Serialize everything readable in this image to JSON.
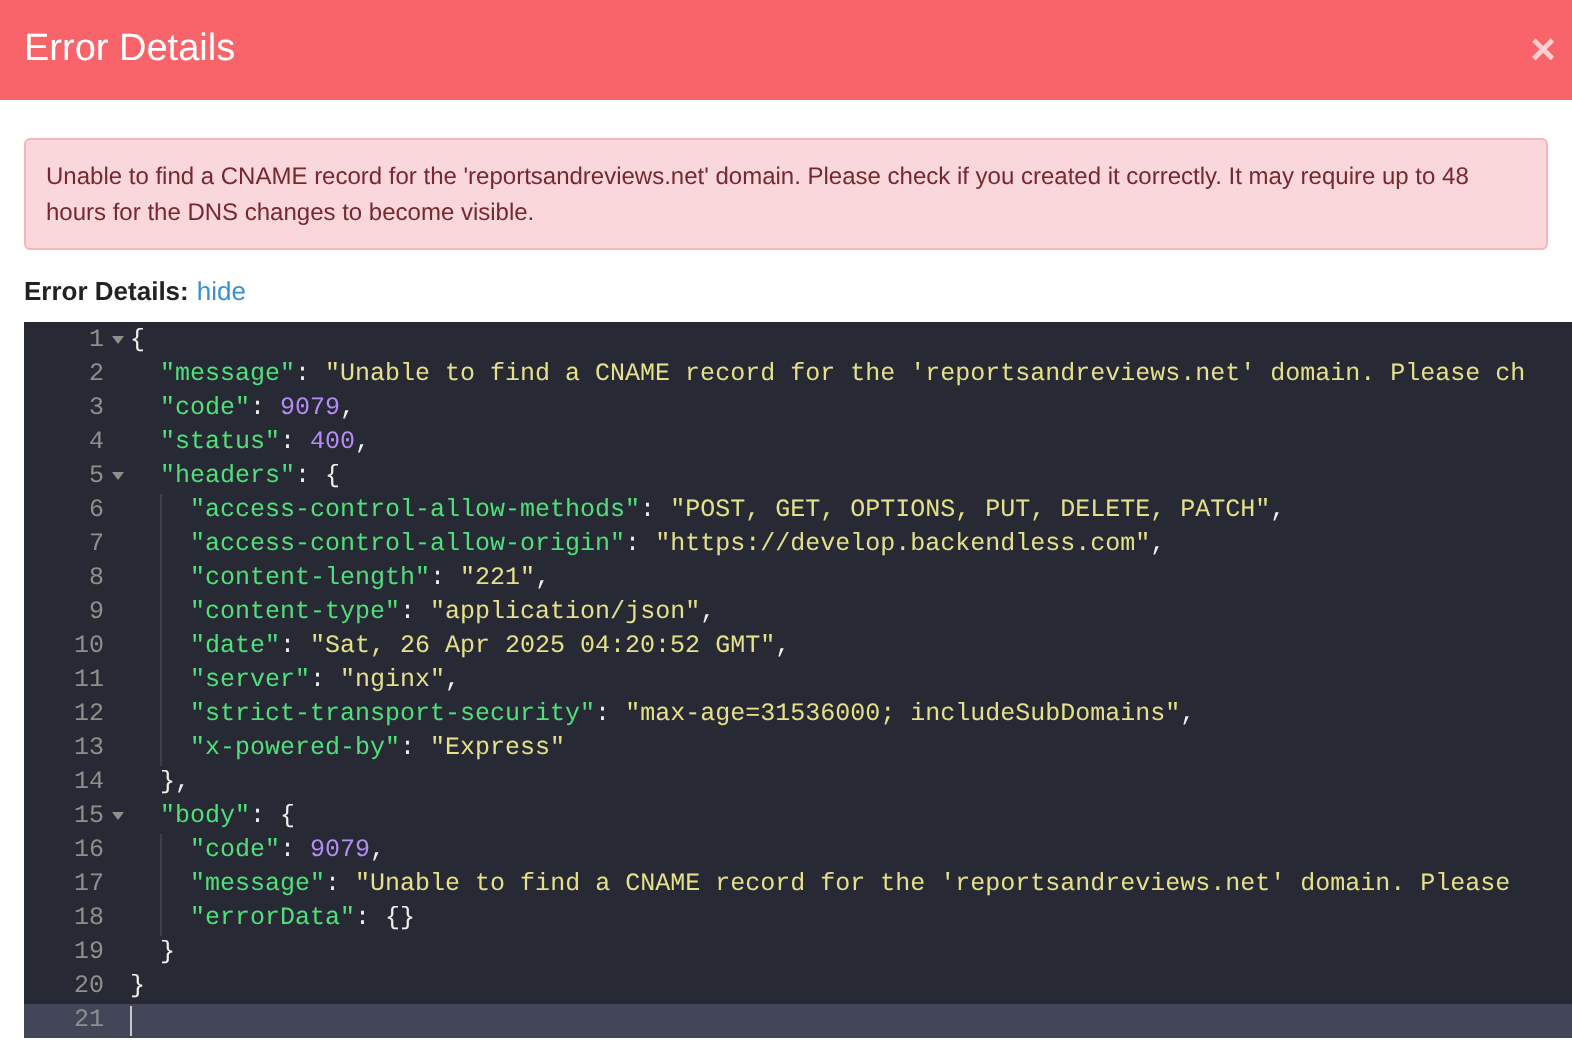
{
  "dialog": {
    "title": "Error Details",
    "close": "×"
  },
  "alert": {
    "text": "Unable to find a CNAME record for the 'reportsandreviews.net' domain. Please check if you created it correctly. It may require up to 48 hours for the DNS changes to become visible."
  },
  "details": {
    "label": "Error Details:",
    "toggle": "hide"
  },
  "editor": {
    "lines": [
      {
        "number": "1",
        "foldable": true,
        "active": false,
        "tokens": [
          {
            "kind": "punct",
            "text": "{"
          }
        ]
      },
      {
        "number": "2",
        "foldable": false,
        "active": false,
        "tokens": [
          {
            "kind": "key",
            "text": "  \"message\""
          },
          {
            "kind": "punct",
            "text": ": "
          },
          {
            "kind": "string",
            "text": "\"Unable to find a CNAME record for the 'reportsandreviews.net' domain. Please ch"
          }
        ]
      },
      {
        "number": "3",
        "foldable": false,
        "active": false,
        "tokens": [
          {
            "kind": "key",
            "text": "  \"code\""
          },
          {
            "kind": "punct",
            "text": ": "
          },
          {
            "kind": "number",
            "text": "9079"
          },
          {
            "kind": "punct",
            "text": ","
          }
        ]
      },
      {
        "number": "4",
        "foldable": false,
        "active": false,
        "tokens": [
          {
            "kind": "key",
            "text": "  \"status\""
          },
          {
            "kind": "punct",
            "text": ": "
          },
          {
            "kind": "number",
            "text": "400"
          },
          {
            "kind": "punct",
            "text": ","
          }
        ]
      },
      {
        "number": "5",
        "foldable": true,
        "active": false,
        "tokens": [
          {
            "kind": "key",
            "text": "  \"headers\""
          },
          {
            "kind": "punct",
            "text": ": {"
          }
        ]
      },
      {
        "number": "6",
        "foldable": false,
        "active": false,
        "tokens": [
          {
            "kind": "key",
            "text": "    \"access-control-allow-methods\""
          },
          {
            "kind": "punct",
            "text": ": "
          },
          {
            "kind": "string",
            "text": "\"POST, GET, OPTIONS, PUT, DELETE, PATCH\""
          },
          {
            "kind": "punct",
            "text": ","
          }
        ]
      },
      {
        "number": "7",
        "foldable": false,
        "active": false,
        "tokens": [
          {
            "kind": "key",
            "text": "    \"access-control-allow-origin\""
          },
          {
            "kind": "punct",
            "text": ": "
          },
          {
            "kind": "string",
            "text": "\"https://develop.backendless.com\""
          },
          {
            "kind": "punct",
            "text": ","
          }
        ]
      },
      {
        "number": "8",
        "foldable": false,
        "active": false,
        "tokens": [
          {
            "kind": "key",
            "text": "    \"content-length\""
          },
          {
            "kind": "punct",
            "text": ": "
          },
          {
            "kind": "string",
            "text": "\"221\""
          },
          {
            "kind": "punct",
            "text": ","
          }
        ]
      },
      {
        "number": "9",
        "foldable": false,
        "active": false,
        "tokens": [
          {
            "kind": "key",
            "text": "    \"content-type\""
          },
          {
            "kind": "punct",
            "text": ": "
          },
          {
            "kind": "string",
            "text": "\"application/json\""
          },
          {
            "kind": "punct",
            "text": ","
          }
        ]
      },
      {
        "number": "10",
        "foldable": false,
        "active": false,
        "tokens": [
          {
            "kind": "key",
            "text": "    \"date\""
          },
          {
            "kind": "punct",
            "text": ": "
          },
          {
            "kind": "string",
            "text": "\"Sat, 26 Apr 2025 04:20:52 GMT\""
          },
          {
            "kind": "punct",
            "text": ","
          }
        ]
      },
      {
        "number": "11",
        "foldable": false,
        "active": false,
        "tokens": [
          {
            "kind": "key",
            "text": "    \"server\""
          },
          {
            "kind": "punct",
            "text": ": "
          },
          {
            "kind": "string",
            "text": "\"nginx\""
          },
          {
            "kind": "punct",
            "text": ","
          }
        ]
      },
      {
        "number": "12",
        "foldable": false,
        "active": false,
        "tokens": [
          {
            "kind": "key",
            "text": "    \"strict-transport-security\""
          },
          {
            "kind": "punct",
            "text": ": "
          },
          {
            "kind": "string",
            "text": "\"max-age=31536000; includeSubDomains\""
          },
          {
            "kind": "punct",
            "text": ","
          }
        ]
      },
      {
        "number": "13",
        "foldable": false,
        "active": false,
        "tokens": [
          {
            "kind": "key",
            "text": "    \"x-powered-by\""
          },
          {
            "kind": "punct",
            "text": ": "
          },
          {
            "kind": "string",
            "text": "\"Express\""
          }
        ]
      },
      {
        "number": "14",
        "foldable": false,
        "active": false,
        "tokens": [
          {
            "kind": "punct",
            "text": "  },"
          }
        ]
      },
      {
        "number": "15",
        "foldable": true,
        "active": false,
        "tokens": [
          {
            "kind": "key",
            "text": "  \"body\""
          },
          {
            "kind": "punct",
            "text": ": {"
          }
        ]
      },
      {
        "number": "16",
        "foldable": false,
        "active": false,
        "tokens": [
          {
            "kind": "key",
            "text": "    \"code\""
          },
          {
            "kind": "punct",
            "text": ": "
          },
          {
            "kind": "number",
            "text": "9079"
          },
          {
            "kind": "punct",
            "text": ","
          }
        ]
      },
      {
        "number": "17",
        "foldable": false,
        "active": false,
        "tokens": [
          {
            "kind": "key",
            "text": "    \"message\""
          },
          {
            "kind": "punct",
            "text": ": "
          },
          {
            "kind": "string",
            "text": "\"Unable to find a CNAME record for the 'reportsandreviews.net' domain. Please"
          }
        ]
      },
      {
        "number": "18",
        "foldable": false,
        "active": false,
        "tokens": [
          {
            "kind": "key",
            "text": "    \"errorData\""
          },
          {
            "kind": "punct",
            "text": ": {}"
          }
        ]
      },
      {
        "number": "19",
        "foldable": false,
        "active": false,
        "tokens": [
          {
            "kind": "punct",
            "text": "  }"
          }
        ]
      },
      {
        "number": "20",
        "foldable": false,
        "active": false,
        "tokens": [
          {
            "kind": "punct",
            "text": "}"
          }
        ]
      },
      {
        "number": "21",
        "foldable": false,
        "active": true
      }
    ]
  }
}
